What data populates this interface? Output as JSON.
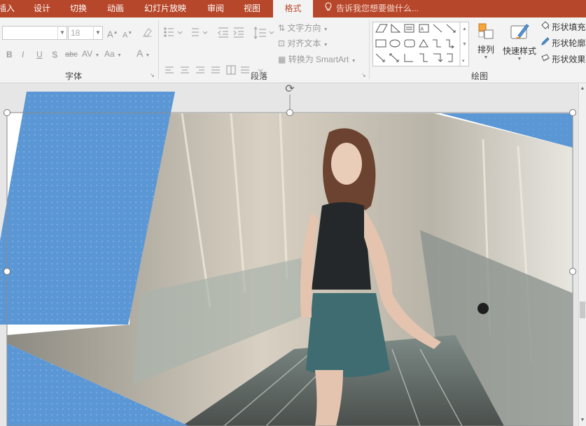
{
  "tabs": [
    {
      "label": "插入"
    },
    {
      "label": "设计"
    },
    {
      "label": "切换"
    },
    {
      "label": "动画"
    },
    {
      "label": "幻灯片放映"
    },
    {
      "label": "审阅"
    },
    {
      "label": "视图"
    },
    {
      "label": "格式",
      "active": true
    }
  ],
  "tell_me": "告诉我您想要做什么...",
  "font": {
    "name_value": "",
    "size_value": "18",
    "grow_label": "A",
    "shrink_label": "A",
    "bold": "B",
    "italic": "I",
    "underline": "U",
    "shadow": "S",
    "strike": "abc",
    "spacing": "AV",
    "case": "Aa",
    "color": "A",
    "group_label": "字体"
  },
  "paragraph": {
    "text_direction": "文字方向",
    "align_text": "对齐文本",
    "smartart": "转换为 SmartArt",
    "group_label": "段落"
  },
  "drawing": {
    "arrange": "排列",
    "quick_styles": "快速样式",
    "shape_fill": "形状填充",
    "shape_outline": "形状轮廓",
    "shape_effects": "形状效果",
    "group_label": "绘图"
  },
  "colors": {
    "accent": "#b7472a",
    "shape_blue": "#5b97d5",
    "ribbon_bg": "#f3f3f3"
  }
}
